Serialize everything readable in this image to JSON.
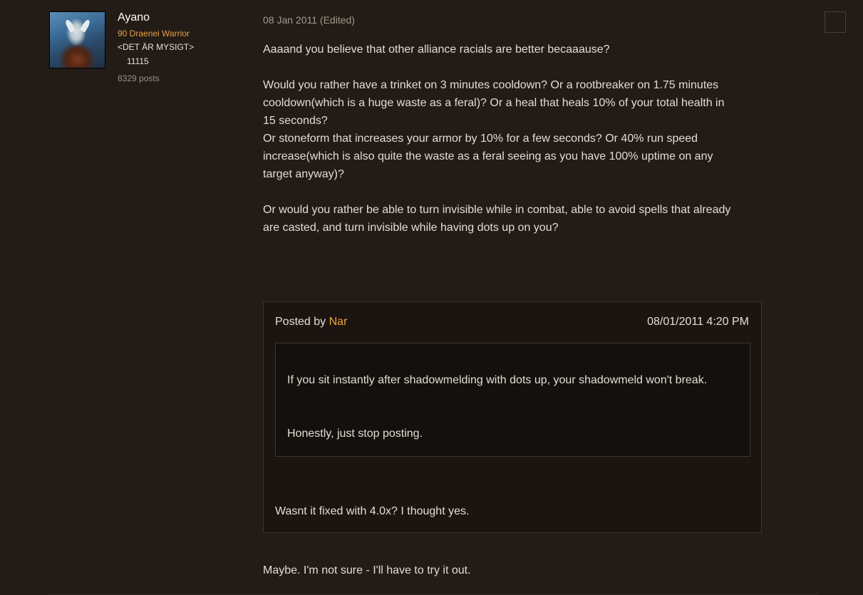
{
  "author": {
    "name": "Ayano",
    "class_line": "90 Draenei Warrior",
    "guild": "<DET ÄR MYSIGT>",
    "achievement_points": "11115",
    "post_count": "8329 posts",
    "class_color": "#e8a04a"
  },
  "post": {
    "date": "08 Jan 2011 (Edited)",
    "paragraphs": {
      "p1": "Aaaand you believe that other alliance racials are better becaaause?",
      "p2_l1": "Would you rather have a trinket on 3 minutes cooldown? Or a rootbreaker on 1.75 minutes",
      "p2_l2": "cooldown(which is a huge waste as a feral)? Or a heal that heals 10% of your total health in",
      "p2_l3": "15 seconds?",
      "p2_l4": "Or stoneform that increases your armor by 10% for a few seconds? Or 40% run speed",
      "p2_l5": "increase(which is also quite the waste as a feral seeing as you have 100% uptime on any",
      "p2_l6": "target anyway)?",
      "p3_l1": "Or would you rather be able to turn invisible while in combat, able to avoid spells that already",
      "p3_l2": "are casted, and turn invisible while having dots up on you?"
    },
    "quote": {
      "posted_by_label": "Posted by",
      "author": "Nar",
      "timestamp": "08/01/2011 4:20 PM",
      "nested_line_1": "If you sit instantly after shadowmelding with dots up, your shadowmeld won't break.",
      "nested_line_2": "Honestly, just stop posting.",
      "reply": "Wasnt it fixed with 4.0x? I thought yes."
    },
    "closing_text": "Maybe. I'm not sure - I'll have to try it out."
  },
  "colors": {
    "background": "#221b16",
    "quote_author": "#f0a43a",
    "text": "#e3ddd3"
  },
  "icons": {
    "post_menu": "post-options-icon"
  }
}
